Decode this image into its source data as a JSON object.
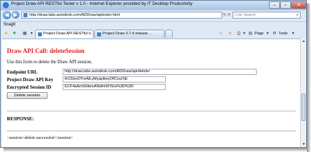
{
  "window": {
    "title": "Project Draw API RESTful Tester v 1.0 - Internet Explorer provided by IT Desktop Productivity"
  },
  "address_bar": {
    "url": "http://draw.labs.autodesk.com/ADDraw/apitester.html"
  },
  "search": {
    "placeholder": "Live Search"
  },
  "links_bar": {
    "snagit": "SnagIt"
  },
  "tabs": [
    {
      "label": "Project Draw API RESTful ..."
    },
    {
      "label": "Project Draw 0.7.4 release ..."
    }
  ],
  "command_bar": {
    "page": "Page",
    "tools": "Tools"
  },
  "page": {
    "heading": "Draw API Call: deleteSession",
    "intro": "Use this form to delete the Draw API session.",
    "fields": [
      {
        "label": "Endpoint URL",
        "value": "http://draw.labs.autodesk.com/ADDraw/api/delete/"
      },
      {
        "label": "Project Draw API Key",
        "value": "th1SlsnOTreAlLyMyapIkeyOfCourSE"
      },
      {
        "label": "Encrypted Session ID",
        "value": "ECF4aAmSHbeoANdHrI9YEw%3D%3D"
      }
    ],
    "button": "Delete session",
    "response_label": "RESPONSE:",
    "response_body": "<session>delete successful</session>"
  }
}
